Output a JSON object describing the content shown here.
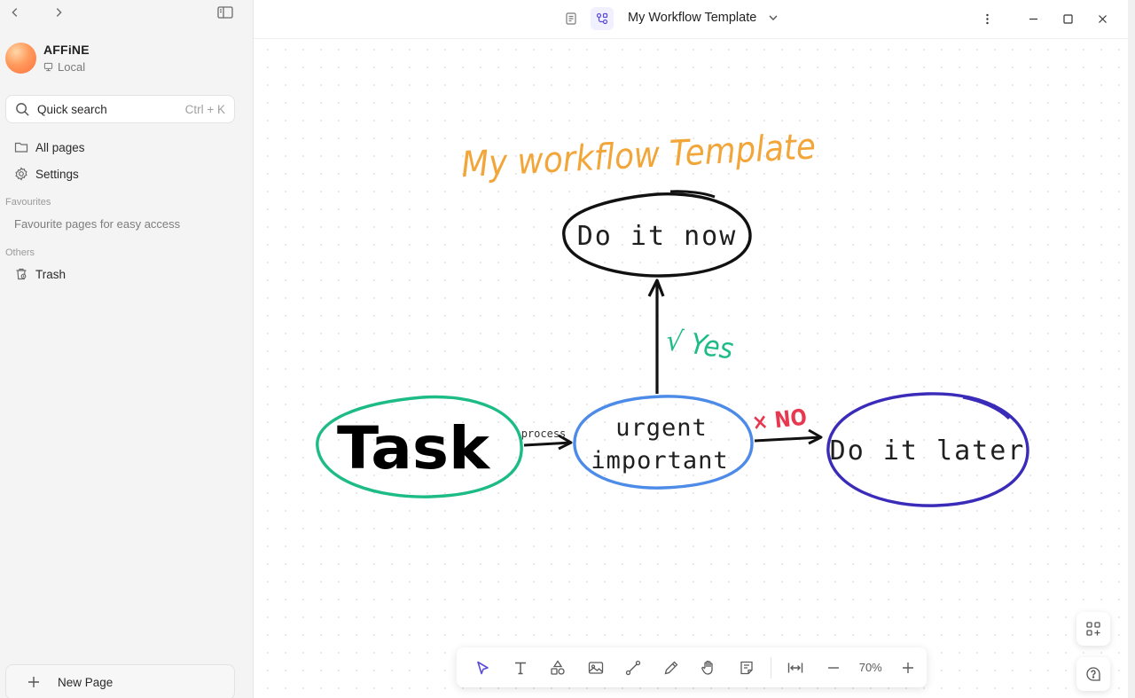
{
  "sidebar": {
    "workspace_name": "AFFiNE",
    "workspace_type": "Local",
    "search_label": "Quick search",
    "search_shortcut": "Ctrl + K",
    "all_pages": "All pages",
    "settings": "Settings",
    "favourites_heading": "Favourites",
    "favourites_empty": "Favourite pages for easy access",
    "others_heading": "Others",
    "trash": "Trash",
    "new_page": "New Page"
  },
  "header": {
    "title": "My Workflow Template"
  },
  "canvas": {
    "handwritten_title": "My workflow Template",
    "node_do_now": "Do it now",
    "node_task": "Task",
    "node_urgent_line1": "urgent",
    "node_urgent_line2": "important",
    "node_do_later": "Do it later",
    "edge_process": "process",
    "label_yes": "√ Yes",
    "label_no": "× NO",
    "colors": {
      "title": "#f2a63a",
      "task": "#1dbb86",
      "urgent": "#4d8be8",
      "later": "#3a2bb8",
      "yes": "#1dbb86",
      "no": "#e8384f"
    }
  },
  "toolbar": {
    "zoom": "70%",
    "tools": [
      "pointer-icon",
      "text-icon",
      "shapes-icon",
      "image-icon",
      "connector-icon",
      "pen-icon",
      "hand-icon",
      "note-icon",
      "fit-width-icon",
      "zoom-out-icon",
      "zoom-in-icon"
    ]
  }
}
